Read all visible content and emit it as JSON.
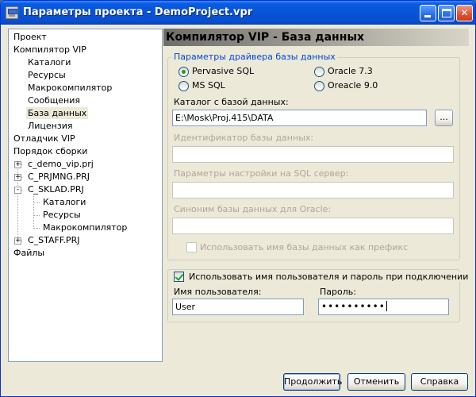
{
  "window": {
    "title": "Параметры проекта - DemoProject.vpr"
  },
  "tree": {
    "items": [
      {
        "label": "Проект"
      },
      {
        "label": "Компилятор VIP"
      },
      {
        "label": "Каталоги"
      },
      {
        "label": "Ресурсы"
      },
      {
        "label": "Макрокомпилятор"
      },
      {
        "label": "Сообщения"
      },
      {
        "label": "База данных",
        "selected": true
      },
      {
        "label": "Лицензия"
      },
      {
        "label": "Отладчик VIP"
      },
      {
        "label": "Порядок сборки"
      },
      {
        "label": "c_demo_vip.prj",
        "expander": "+"
      },
      {
        "label": "C_PRJMNG.PRJ",
        "expander": "+"
      },
      {
        "label": "C_SKLAD.PRJ",
        "expander": "-"
      },
      {
        "label": "Каталоги"
      },
      {
        "label": "Ресурсы"
      },
      {
        "label": "Макрокомпилятор"
      },
      {
        "label": "C_STAFF.PRJ",
        "expander": "+"
      },
      {
        "label": "Файлы"
      }
    ]
  },
  "panel": {
    "header": "Компилятор VIP - База данных",
    "driver_group": {
      "legend": "Параметры драйвера базы данных",
      "radios": {
        "pervasive": {
          "label": "Pervasive SQL",
          "checked": true
        },
        "mssql": {
          "label": "MS SQL",
          "checked": false
        },
        "oracle73": {
          "label": "Oracle 7.3",
          "checked": false
        },
        "oracle90": {
          "label": "Oreacle 9.0",
          "checked": false
        }
      },
      "catalog_label": "Каталог с базой данных:",
      "catalog_value": "E:\\Mosk\\Proj.415\\DATA",
      "browse_label": "...",
      "db_id_label": "Идентификатор базы данных:",
      "db_id_value": "",
      "sql_params_label": "Параметры настройки на SQL сервер:",
      "sql_params_value": "",
      "oracle_synonym_label": "Синоним базы данных для Oracle:",
      "oracle_synonym_value": "",
      "prefix_checkbox_label": "Использовать имя базы данных как префикс",
      "prefix_checked": false
    },
    "login_group": {
      "checkbox_label": "Использовать имя пользователя и пароль при подключении",
      "checked": true,
      "username_label": "Имя пользователя:",
      "username_value": "User",
      "password_label": "Пароль:",
      "password_value": "••••••••••"
    }
  },
  "buttons": {
    "continue": "Продолжить",
    "cancel": "Отменить",
    "help": "Справка"
  }
}
